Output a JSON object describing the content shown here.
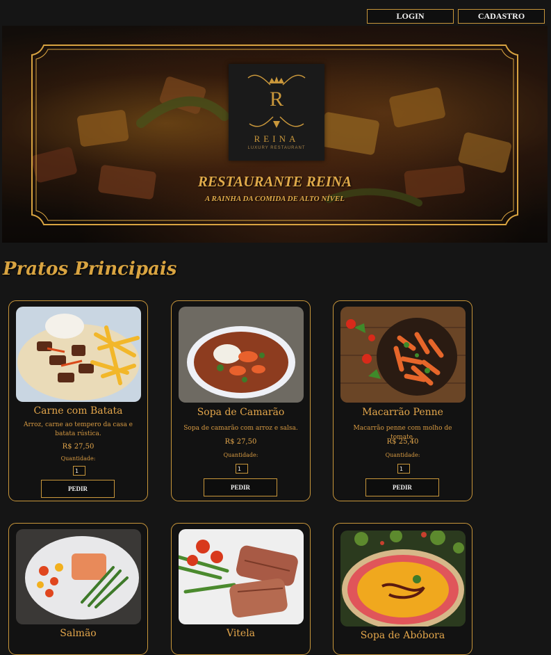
{
  "header": {
    "login_label": "LOGIN",
    "signup_label": "CADASTRO"
  },
  "hero": {
    "logo_letter": "R",
    "logo_name": "REINA",
    "logo_sub": "LUXURY RESTAURANT",
    "title": "RESTAURANTE REINA",
    "subtitle": "A RAINHA DA COMIDA DE ALTO NÍVEL"
  },
  "section": {
    "title": "Pratos Principais"
  },
  "dishes": [
    {
      "name": "Carne com Batata",
      "desc": "Arroz, carne ao tempero da casa e batata rústica.",
      "price": "R$ 27,50",
      "qty_label": "Quantidade:",
      "qty": "1",
      "order_label": "PEDIR"
    },
    {
      "name": "Sopa de Camarão",
      "desc": "Sopa de camarão com arroz e salsa.",
      "price": "R$ 27,50",
      "qty_label": "Quantidade:",
      "qty": "1",
      "order_label": "PEDIR"
    },
    {
      "name": "Macarrão Penne",
      "desc": "Macarrão penne com molho de tomate.",
      "price": "R$ 25,40",
      "qty_label": "Quantidade:",
      "qty": "1",
      "order_label": "PEDIR"
    },
    {
      "name": "Salmão"
    },
    {
      "name": "Vitela"
    },
    {
      "name": "Sopa de Abóbora"
    }
  ],
  "colors": {
    "gold": "#c9973b",
    "background": "#151515"
  }
}
